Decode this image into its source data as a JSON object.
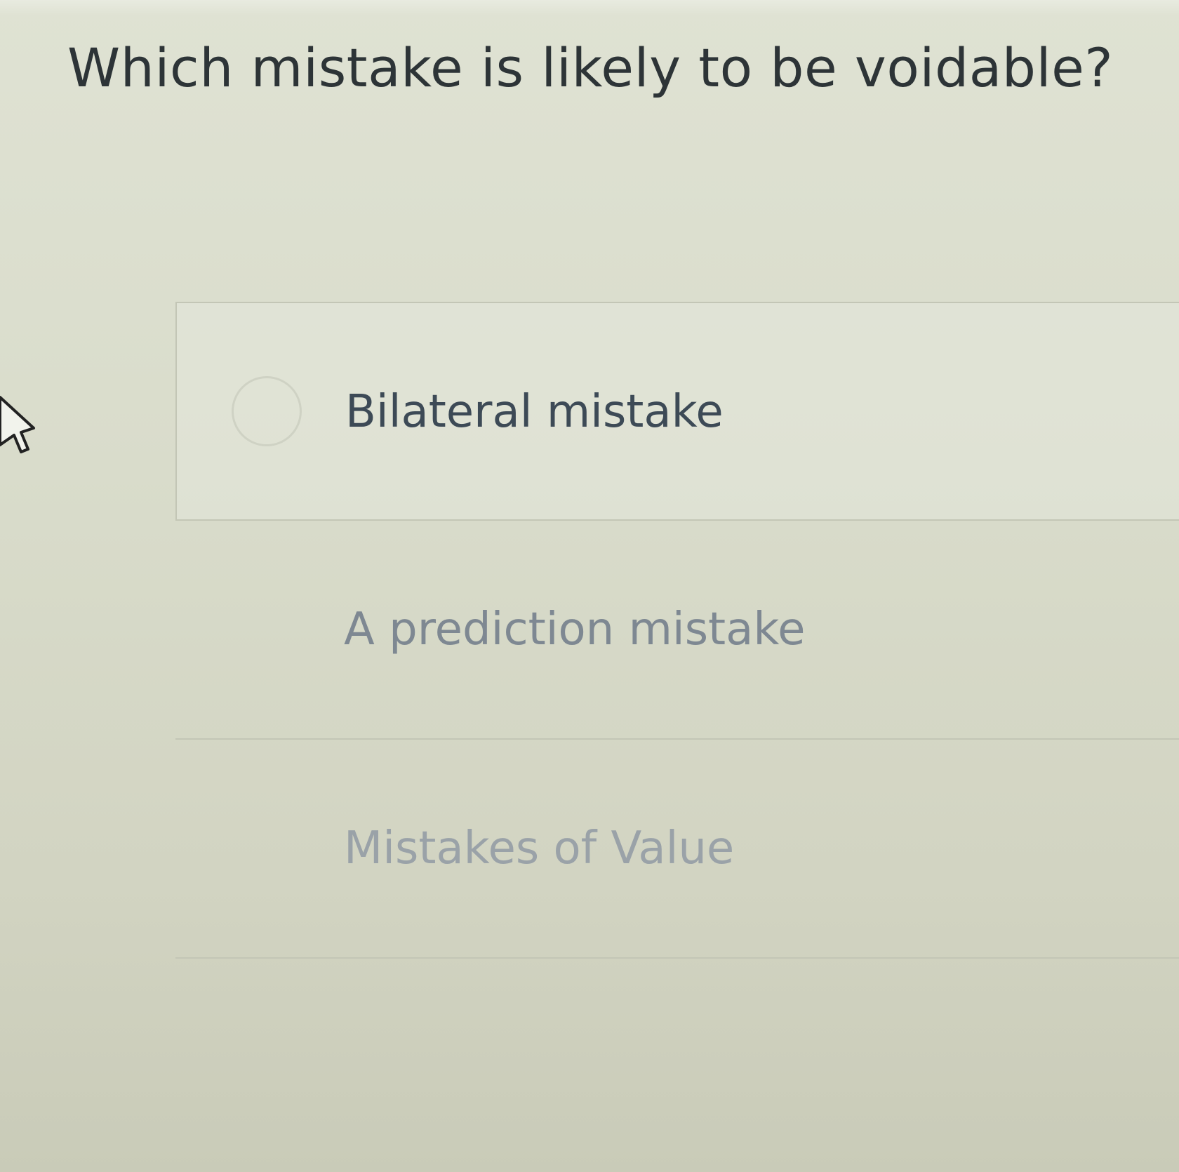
{
  "question": {
    "title": "Which mistake is likely to be voidable?"
  },
  "options": [
    {
      "label": "Bilateral mistake",
      "selected": false
    },
    {
      "label": "A prediction mistake",
      "selected": false
    },
    {
      "label": "Mistakes of Value",
      "selected": false
    }
  ],
  "icons": {
    "cursor": "mouse-pointer-icon",
    "radio": "radio-button-icon"
  },
  "colors": {
    "background": "#dadccc",
    "title_text": "#2d3437",
    "option_text": "#3d4a56",
    "border": "#c3c6b6"
  }
}
